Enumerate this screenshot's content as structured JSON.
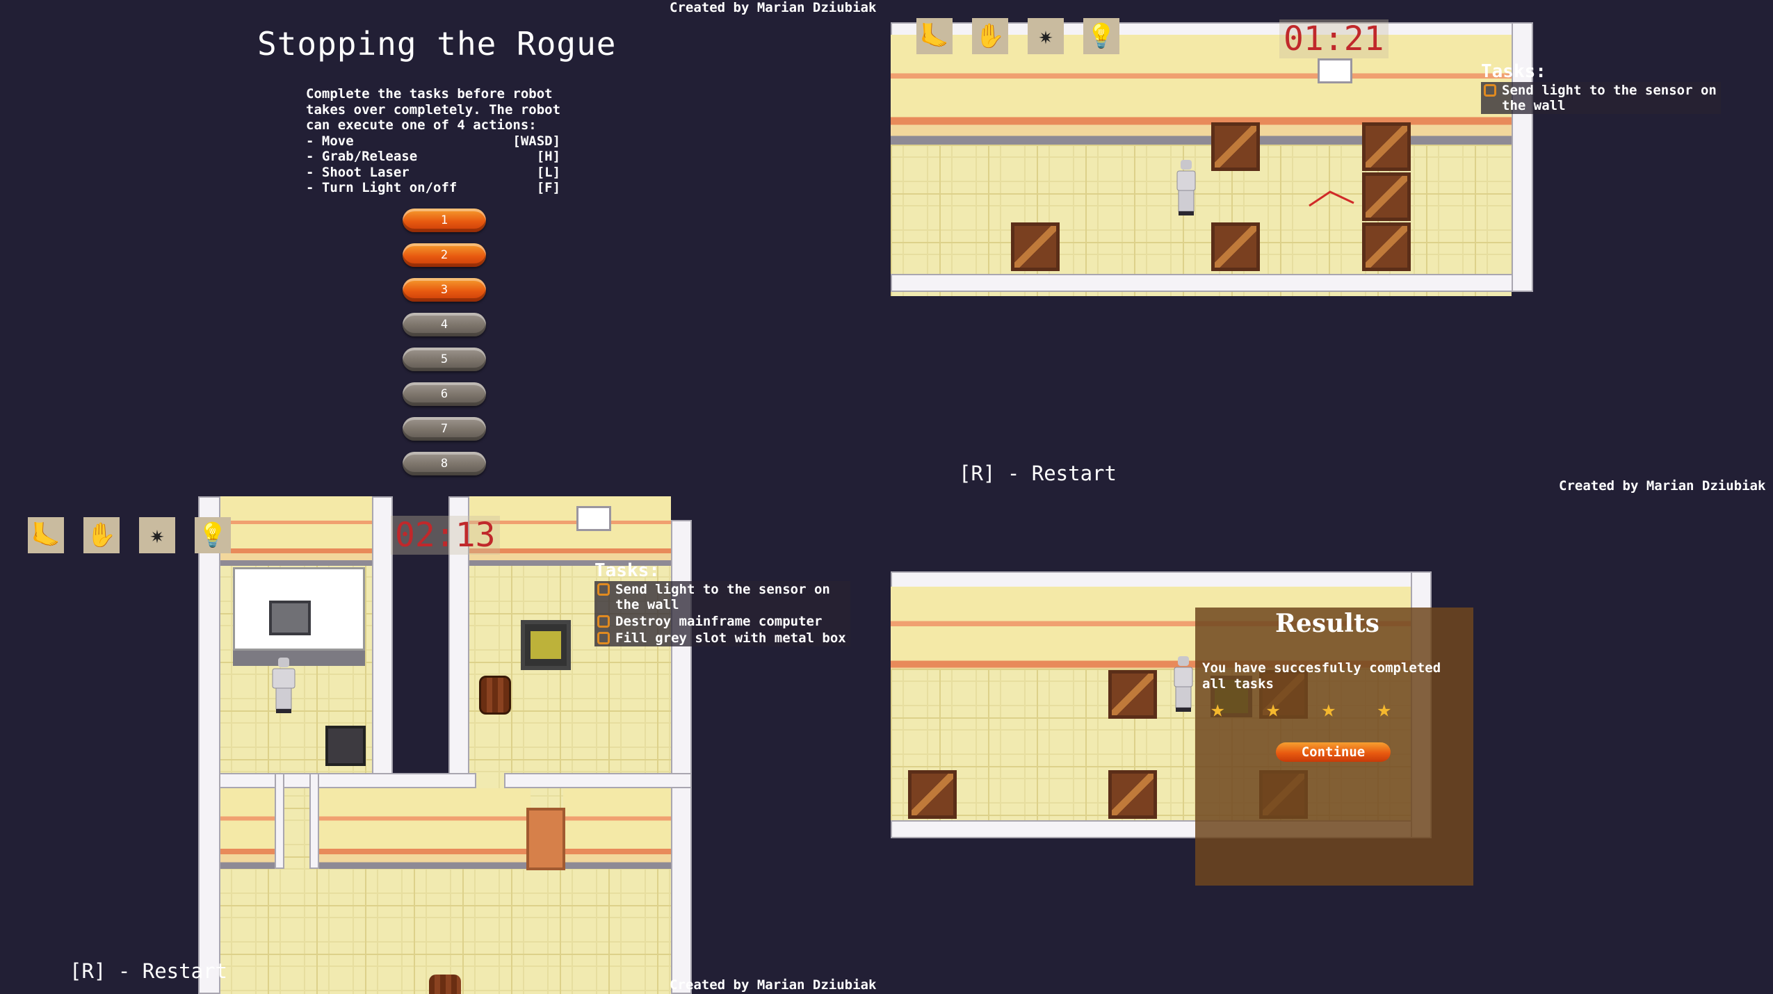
{
  "credits": [
    "Created by Marian Dziubiak",
    "Created by Marian Dziubiak",
    "Created by Marian Dziubiak"
  ],
  "menu": {
    "title": "Stopping the Rogue",
    "description": "Complete the tasks before robot\ntakes over completely. The robot\ncan execute one of 4 actions:\n- Move                    [WASD]\n- Grab/Release               [H]\n- Shoot Laser                [L]\n- Turn Light on/off          [F]",
    "levels": [
      {
        "label": "1",
        "unlocked": true
      },
      {
        "label": "2",
        "unlocked": true
      },
      {
        "label": "3",
        "unlocked": true
      },
      {
        "label": "4",
        "unlocked": false
      },
      {
        "label": "5",
        "unlocked": false
      },
      {
        "label": "6",
        "unlocked": false
      },
      {
        "label": "7",
        "unlocked": false
      },
      {
        "label": "8",
        "unlocked": false
      }
    ]
  },
  "level_top": {
    "timer": "01:21",
    "tasks_heading": "Tasks:",
    "tasks": [
      "Send light to the sensor on\nthe wall"
    ],
    "restart": "[R] - Restart"
  },
  "level_left": {
    "timer": "02:13",
    "tasks_heading": "Tasks:",
    "tasks": [
      "Send light to the sensor on\nthe wall",
      "Destroy mainframe computer",
      "Fill grey slot with metal box"
    ],
    "restart": "[R] - Restart"
  },
  "results": {
    "title": "Results",
    "message": "You have succesfully completed\nall tasks",
    "stars": 4,
    "continue_label": "Continue"
  },
  "actions_icons": [
    "move-icon",
    "grab-icon",
    "laser-icon",
    "light-bulb-icon"
  ],
  "colors": {
    "background": "#221f35",
    "timer": "#c0282b",
    "button_active": "#e85a10",
    "button_locked": "#7b736a"
  }
}
